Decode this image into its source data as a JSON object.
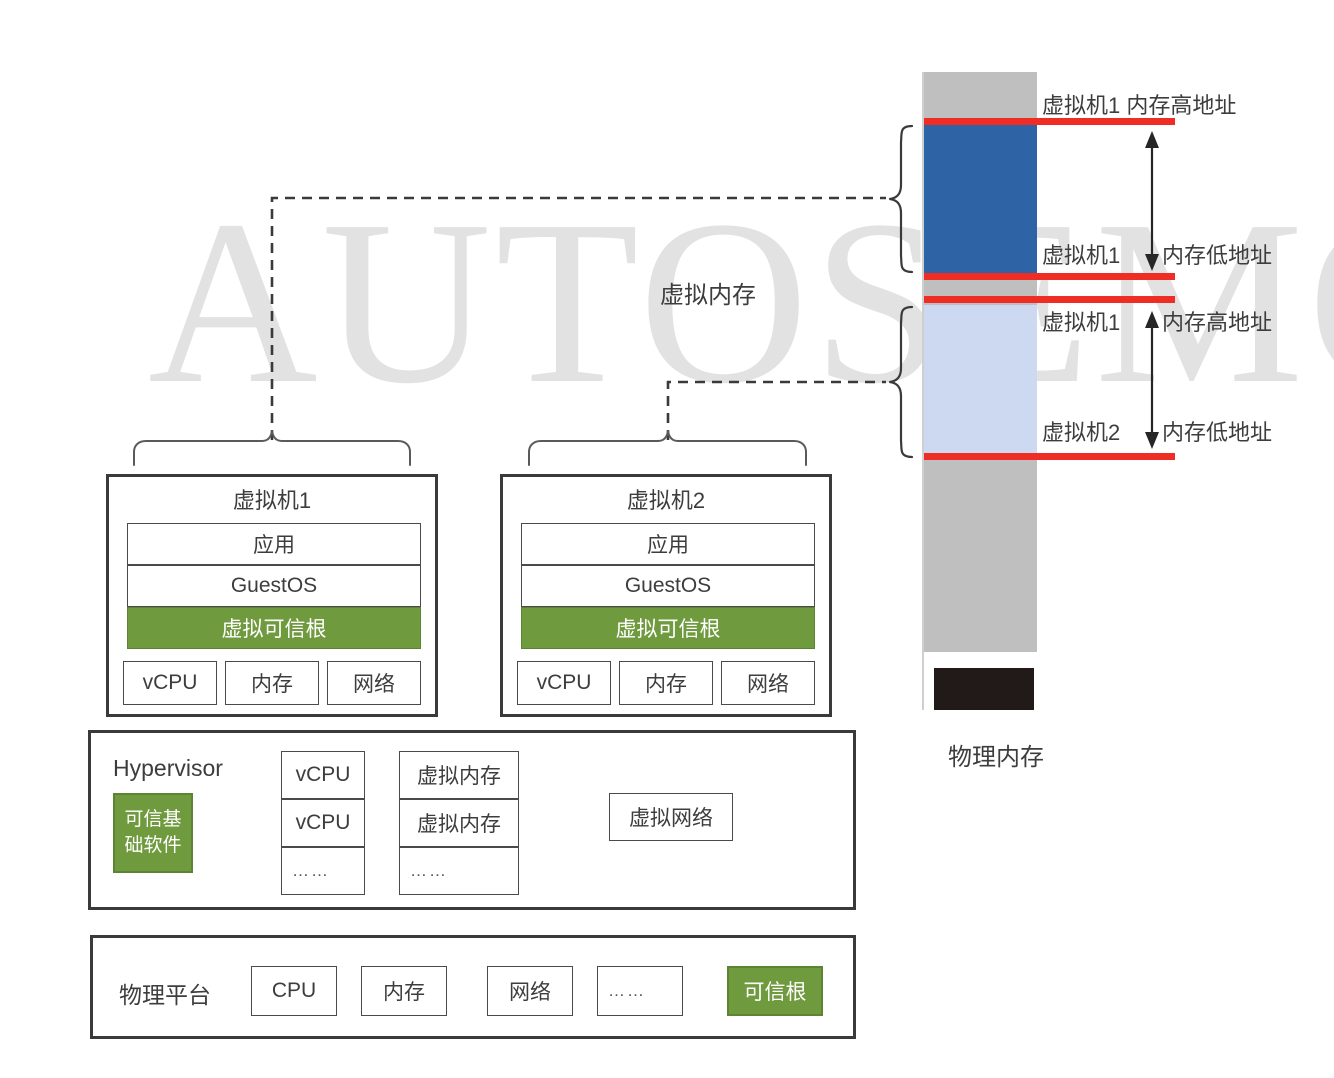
{
  "watermark": {
    "text": "AUTOSEMO"
  },
  "virtual_memory_label": "虚拟内存",
  "physical_memory_label": "物理内存",
  "memory_labels": {
    "vm1_high": "虚拟机1  内存高地址",
    "vm1_low_left": "虚拟机1",
    "vm1_low_right": "内存低地址",
    "vm2_high_left": "虚拟机1",
    "vm2_high_right": "内存高地址",
    "vm2_low_left": "虚拟机2",
    "vm2_low_right": "内存低地址"
  },
  "vms": [
    {
      "title": "虚拟机1",
      "stack": [
        {
          "label": "应用",
          "style": "plain"
        },
        {
          "label": "GuestOS",
          "style": "plain"
        },
        {
          "label": "虚拟可信根",
          "style": "green"
        }
      ],
      "resources": [
        "vCPU",
        "内存",
        "网络"
      ]
    },
    {
      "title": "虚拟机2",
      "stack": [
        {
          "label": "应用",
          "style": "plain"
        },
        {
          "label": "GuestOS",
          "style": "plain"
        },
        {
          "label": "虚拟可信根",
          "style": "green"
        }
      ],
      "resources": [
        "vCPU",
        "内存",
        "网络"
      ]
    }
  ],
  "hypervisor": {
    "title": "Hypervisor",
    "trusted_base": "可信基\n础软件",
    "trusted_base_line1": "可信基",
    "trusted_base_line2": "础软件",
    "vcpu_column": [
      "vCPU",
      "vCPU",
      "……"
    ],
    "vmem_column": [
      "虚拟内存",
      "虚拟内存",
      "……"
    ],
    "vnet": "虚拟网络"
  },
  "platform": {
    "title": "物理平台",
    "items": [
      "CPU",
      "内存",
      "网络",
      "……"
    ],
    "trusted_root": "可信根"
  },
  "colors": {
    "green": "#6f9a3e",
    "blue": "#2e63a5",
    "light_blue": "#ccd9f0",
    "gray": "#bfbfbf",
    "red": "#ee2d24",
    "dark": "#211a18",
    "watermark": "#e2e2e2"
  }
}
